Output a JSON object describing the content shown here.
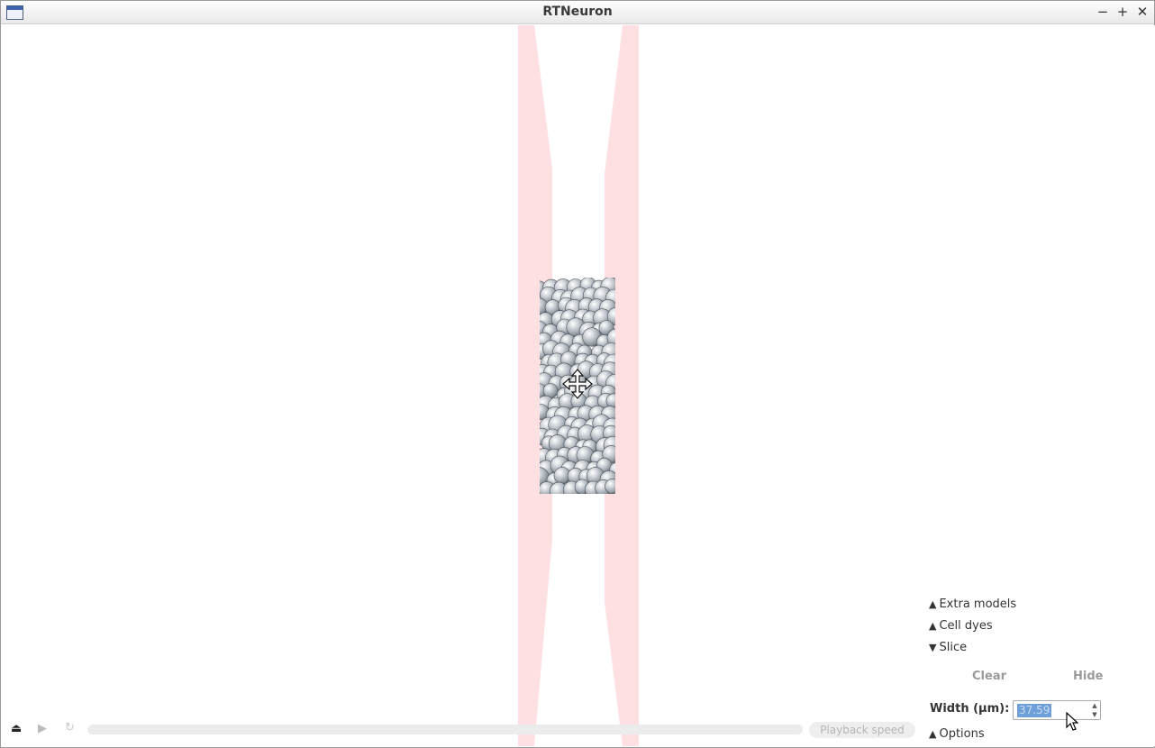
{
  "window": {
    "title": "RTNeuron",
    "app_icon": "window-icon",
    "controls": {
      "minimize": "−",
      "maximize": "+",
      "close": "✕"
    }
  },
  "viewport": {
    "background": "#ffffff",
    "slice_band_color": "#ffe0e2",
    "sphere_color": "#a9b0b7",
    "move_cursor_icon": "move-cursor-icon"
  },
  "panel": {
    "extra_models": {
      "arrow": "▲",
      "label": "Extra models"
    },
    "cell_dyes": {
      "arrow": "▲",
      "label": "Cell dyes"
    },
    "slice": {
      "arrow": "▼",
      "label": "Slice"
    },
    "clear_label": "Clear",
    "hide_label": "Hide",
    "width_label": "Width (μm):",
    "width_value": "37.59",
    "options": {
      "arrow": "▲",
      "label": "Options"
    }
  },
  "playback": {
    "eject_icon": "⏏",
    "play_icon": "▶",
    "loop_icon": "↻",
    "speed_label": "Playback speed"
  }
}
